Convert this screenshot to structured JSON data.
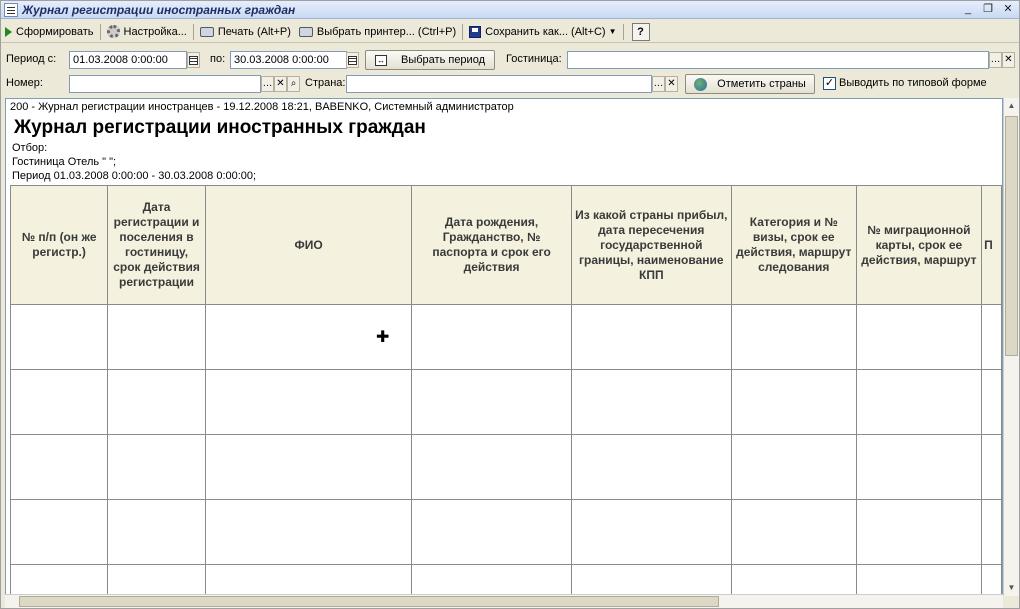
{
  "window": {
    "title": "Журнал регистрации иностранных граждан",
    "controls": [
      "_",
      "❐",
      "✕"
    ]
  },
  "toolbar": {
    "form_label": "Сформировать",
    "settings_label": "Настройка...",
    "print_label": "Печать (Alt+P)",
    "printer_label": "Выбрать принтер... (Ctrl+P)",
    "save_label": "Сохранить как... (Alt+C)",
    "help_label": "?"
  },
  "filters": {
    "period_from_label": "Период с:",
    "period_from_value": "01.03.2008  0:00:00",
    "period_to_label": "по:",
    "period_to_value": "30.03.2008  0:00:00",
    "choose_period_label": "Выбрать период",
    "hotel_label": "Гостиница:",
    "hotel_value": "",
    "number_label": "Номер:",
    "number_value": "",
    "country_label": "Страна:",
    "country_value": "",
    "mark_countries_label": "Отметить страны",
    "standard_form_label": "Выводить по типовой форме",
    "standard_form_checked": true
  },
  "report": {
    "header_line": "200 - Журнал регистрации иностранцев - 19.12.2008 18:21, BABENKO, Системный администратор",
    "title": "Журнал регистрации иностранных граждан",
    "filter_label": "Отбор:",
    "hotel_line": "Гостиница Отель \"            \";",
    "period_line": "Период 01.03.2008 0:00:00 - 30.03.2008 0:00:00;",
    "columns": [
      "№ п/п (он же регистр.)",
      "Дата регистрации и поселения в гостиницу, срок действия регистрации",
      "ФИО",
      "Дата рождения, Гражданство, № паспорта и срок его действия",
      "Из какой страны прибыл, дата пересечения государственной границы, наименование КПП",
      "Категория и № визы, срок ее действия, маршрут следования",
      "№ миграционной карты, срок ее действия, маршрут",
      "П"
    ],
    "rows": 5
  }
}
